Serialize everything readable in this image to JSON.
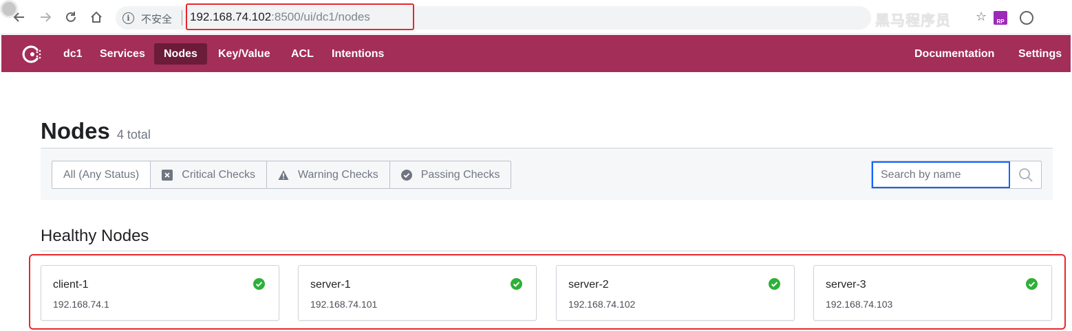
{
  "browser": {
    "security_label": "不安全",
    "url_host": "192.168.74.102",
    "url_rest": ":8500/ui/dc1/nodes",
    "watermark": "黑马程序员"
  },
  "navbar": {
    "color": "#a32e57",
    "active_color": "#6a1c38",
    "datacenter": "dc1",
    "items": [
      {
        "label": "Services"
      },
      {
        "label": "Nodes",
        "active": true
      },
      {
        "label": "Key/Value"
      },
      {
        "label": "ACL"
      },
      {
        "label": "Intentions"
      }
    ],
    "right_items": [
      {
        "label": "Documentation"
      },
      {
        "label": "Settings"
      }
    ]
  },
  "page": {
    "title": "Nodes",
    "count": "4 total"
  },
  "filters": [
    {
      "label": "All (Any Status)",
      "icon": null
    },
    {
      "label": "Critical Checks",
      "icon": "critical-icon"
    },
    {
      "label": "Warning Checks",
      "icon": "warning-icon"
    },
    {
      "label": "Passing Checks",
      "icon": "passing-icon"
    }
  ],
  "search": {
    "placeholder": "Search by name"
  },
  "healthy": {
    "title": "Healthy Nodes",
    "status_color": "#2eb039",
    "nodes": [
      {
        "name": "client-1",
        "address": "192.168.74.1"
      },
      {
        "name": "server-1",
        "address": "192.168.74.101"
      },
      {
        "name": "server-2",
        "address": "192.168.74.102"
      },
      {
        "name": "server-3",
        "address": "192.168.74.103"
      }
    ]
  }
}
